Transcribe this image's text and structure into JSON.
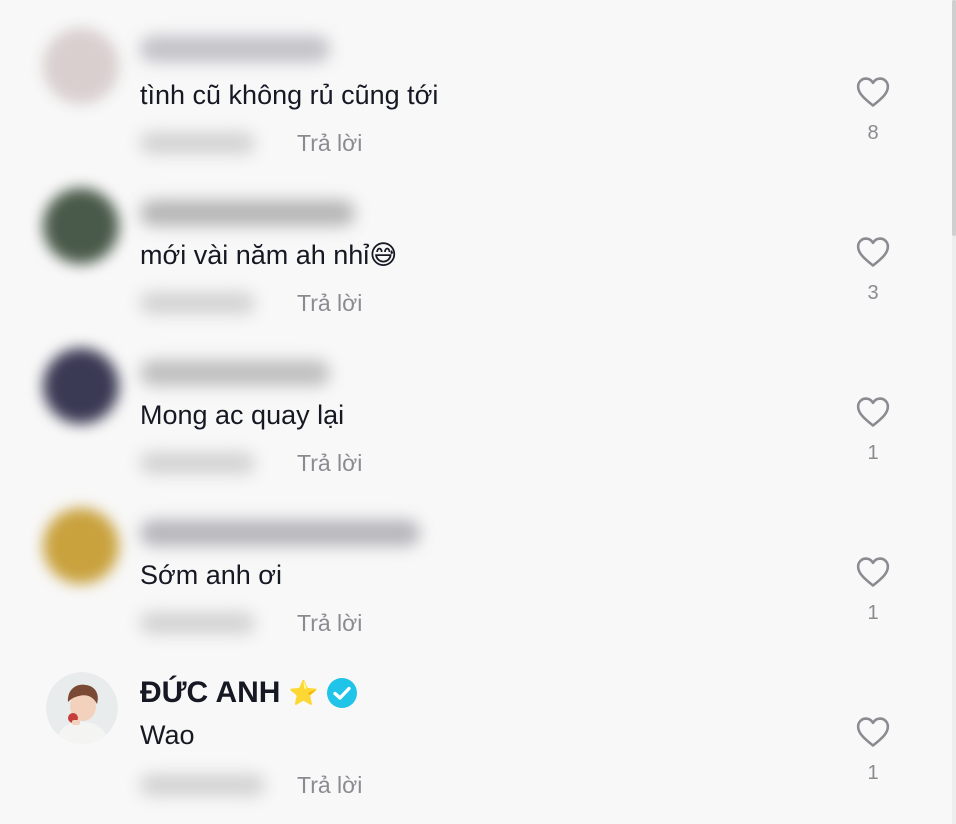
{
  "comments": [
    {
      "text": "tình cũ không rủ cũng tới",
      "reply_label": "Trả lời",
      "like_count": "8",
      "avatar_color": "#d9cfcf",
      "name_blur_color": "#b8b8bf"
    },
    {
      "text": "mới vài năm ah nhỉ😅",
      "reply_label": "Trả lời",
      "like_count": "3",
      "avatar_color": "#4a5a4a",
      "name_blur_color": "#aaaaaa"
    },
    {
      "text": "Mong ac quay lại",
      "reply_label": "Trả lời",
      "like_count": "1",
      "avatar_color": "#3b3a55",
      "name_blur_color": "#b5b5b5"
    },
    {
      "text": "Sớm anh ơi",
      "reply_label": "Trả lời",
      "like_count": "1",
      "avatar_color": "#c9a23e",
      "name_blur_color": "#a9a9b0"
    },
    {
      "name": "ĐỨC ANH",
      "name_emoji": "⭐",
      "verified": true,
      "text": "Wao",
      "reply_label": "Trả lời",
      "like_count": "1",
      "verified_color": "#20c4e8"
    }
  ]
}
